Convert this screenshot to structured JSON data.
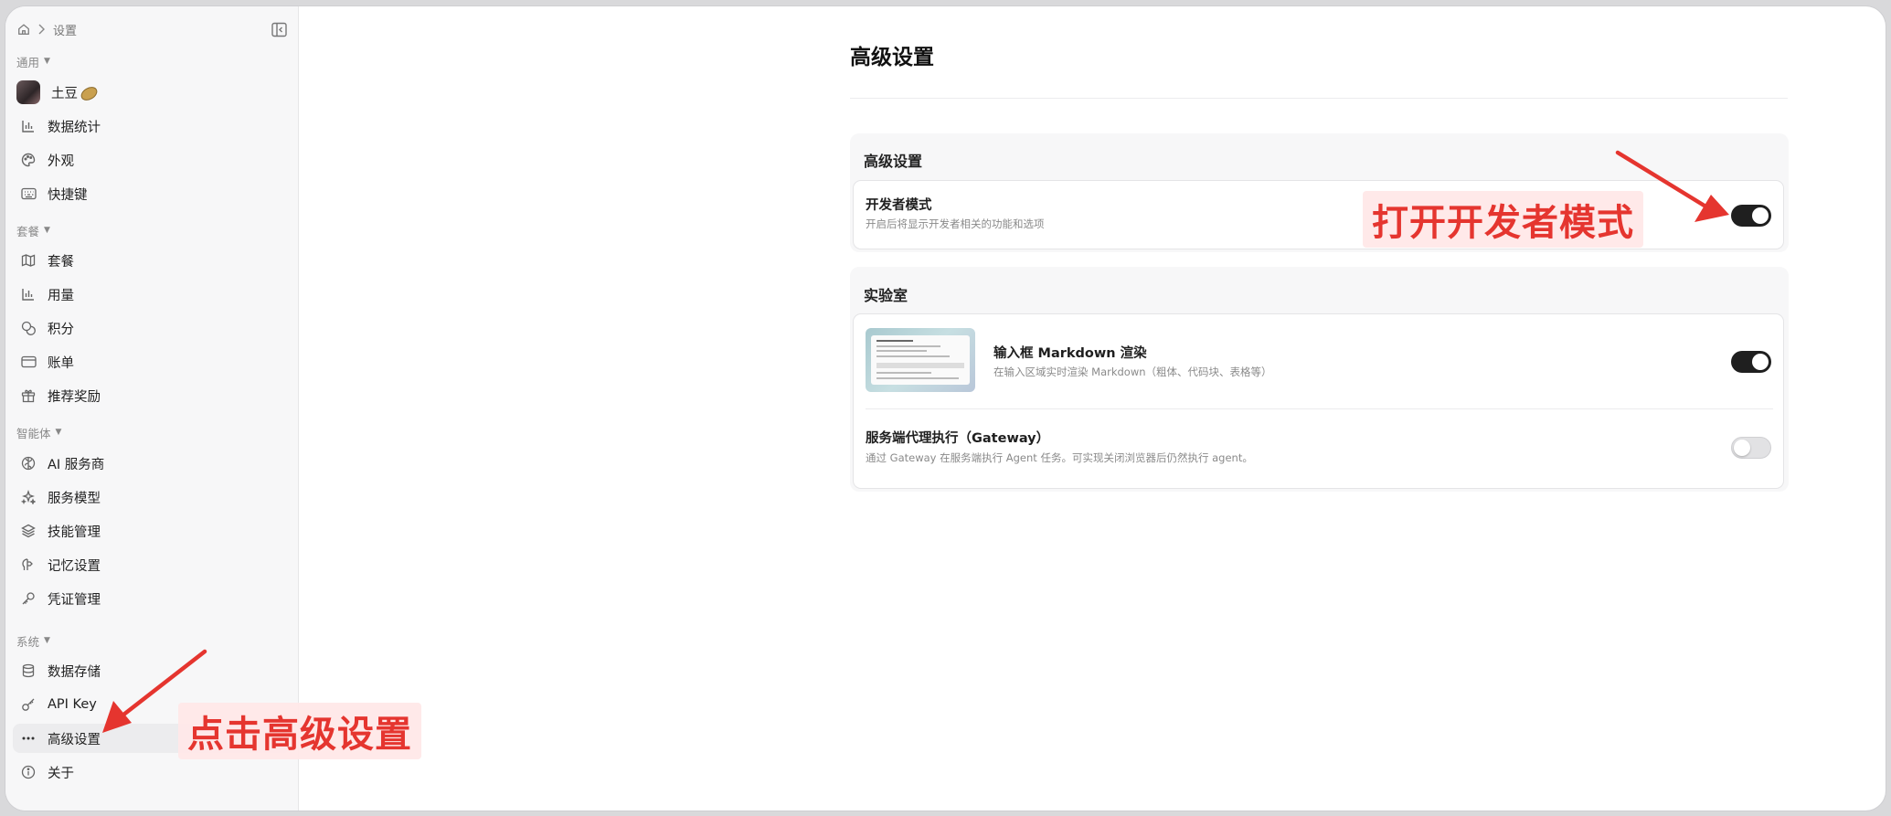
{
  "breadcrumb": {
    "current": "设置"
  },
  "sidebar": {
    "sections": [
      {
        "title": "通用",
        "items": [
          {
            "label": "土豆",
            "icon": "avatar"
          },
          {
            "label": "数据统计",
            "icon": "bar-chart-icon"
          },
          {
            "label": "外观",
            "icon": "palette-icon"
          },
          {
            "label": "快捷键",
            "icon": "keyboard-icon"
          }
        ]
      },
      {
        "title": "套餐",
        "items": [
          {
            "label": "套餐",
            "icon": "map-icon"
          },
          {
            "label": "用量",
            "icon": "bar-chart-icon"
          },
          {
            "label": "积分",
            "icon": "coins-icon"
          },
          {
            "label": "账单",
            "icon": "card-icon"
          },
          {
            "label": "推荐奖励",
            "icon": "gift-icon"
          }
        ]
      },
      {
        "title": "智能体",
        "items": [
          {
            "label": "AI 服务商",
            "icon": "brain-icon"
          },
          {
            "label": "服务模型",
            "icon": "sparkles-icon"
          },
          {
            "label": "技能管理",
            "icon": "layers-icon"
          },
          {
            "label": "记忆设置",
            "icon": "memory-icon"
          },
          {
            "label": "凭证管理",
            "icon": "key-icon"
          }
        ]
      },
      {
        "title": "系统",
        "items": [
          {
            "label": "数据存储",
            "icon": "database-icon"
          },
          {
            "label": "API Key",
            "icon": "api-key-icon"
          },
          {
            "label": "高级设置",
            "icon": "more-icon",
            "active": true
          },
          {
            "label": "关于",
            "icon": "info-icon"
          }
        ]
      }
    ]
  },
  "main": {
    "title": "高级设置",
    "advanced_group": {
      "title": "高级设置",
      "developer_mode": {
        "title": "开发者模式",
        "desc": "开启后将显示开发者相关的功能和选项",
        "enabled": true
      }
    },
    "lab_group": {
      "title": "实验室",
      "markdown": {
        "title": "输入框 Markdown 渲染",
        "desc": "在输入区域实时渲染 Markdown（粗体、代码块、表格等）",
        "enabled": true
      },
      "gateway": {
        "title": "服务端代理执行（Gateway）",
        "desc": "通过 Gateway 在服务端执行 Agent 任务。可实现关闭浏览器后仍然执行 agent。",
        "enabled": false
      }
    }
  },
  "annotations": {
    "toggle_hint": "打开开发者模式",
    "sidebar_hint": "点击高级设置",
    "color": "#e5352f"
  }
}
